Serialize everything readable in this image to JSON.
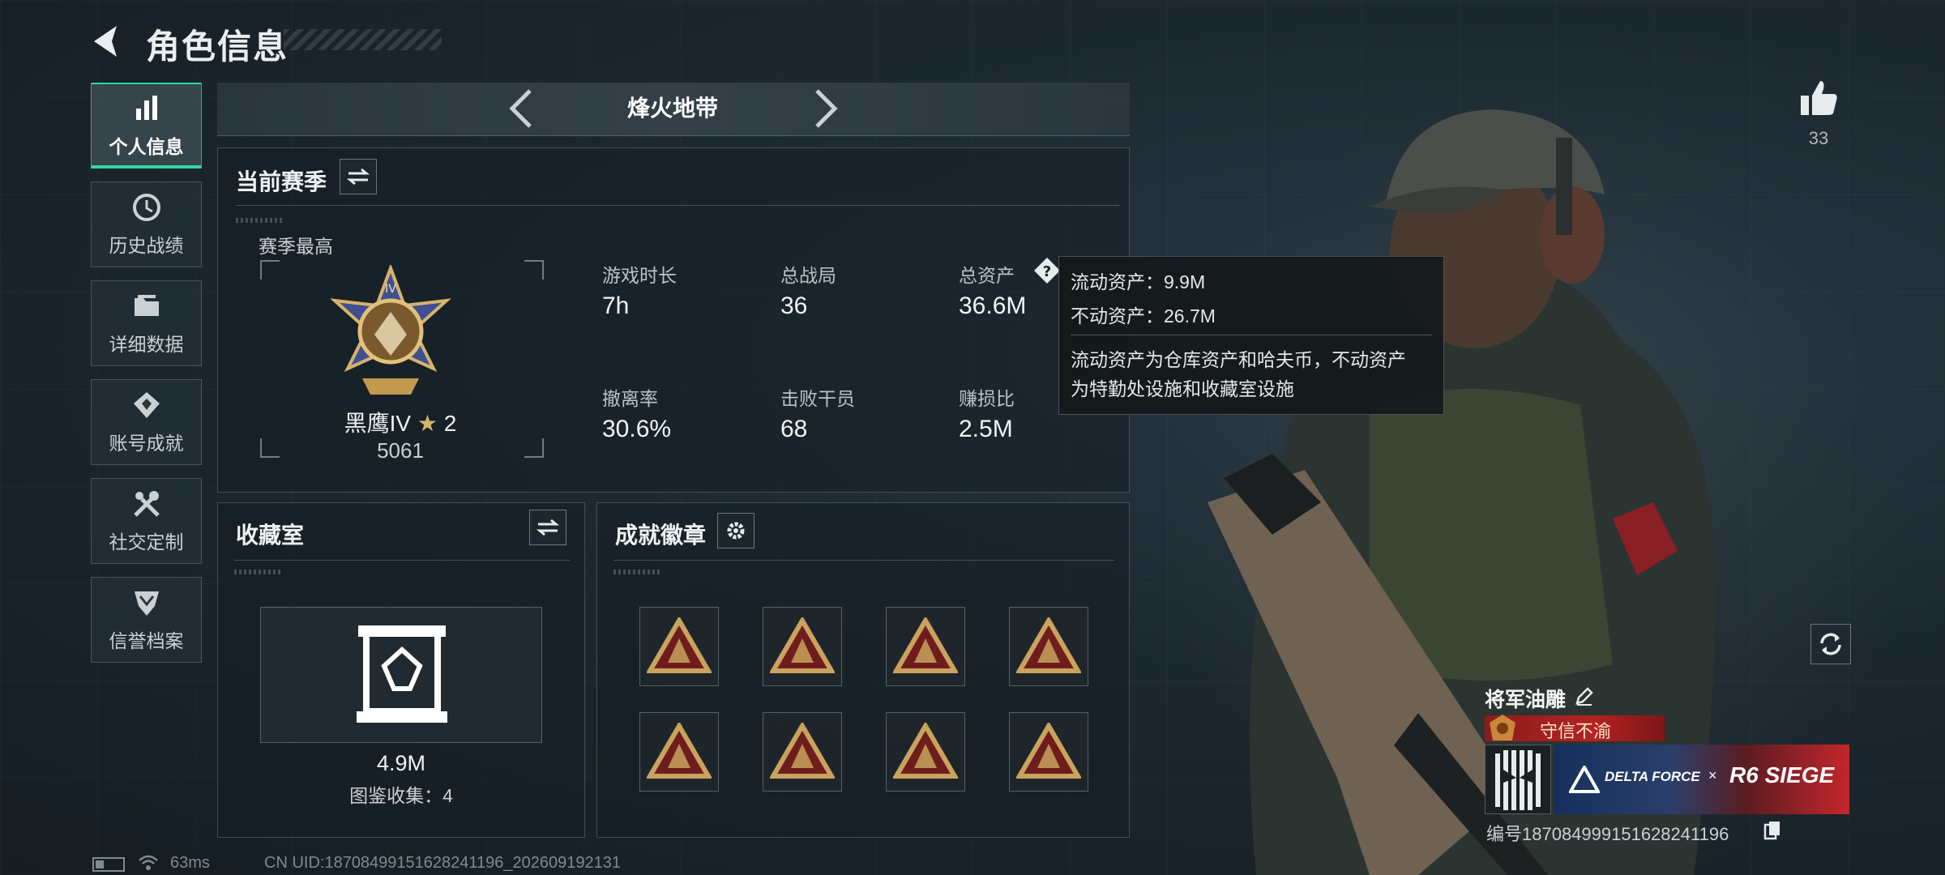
{
  "header": {
    "title": "角色信息"
  },
  "sidebar": {
    "items": [
      {
        "label": "个人信息",
        "icon": "bar-chart-icon",
        "active": true
      },
      {
        "label": "历史战绩",
        "icon": "clock-icon",
        "active": false
      },
      {
        "label": "详细数据",
        "icon": "folder-icon",
        "active": false
      },
      {
        "label": "账号成就",
        "icon": "achievement-icon",
        "active": false
      },
      {
        "label": "社交定制",
        "icon": "tools-icon",
        "active": false
      },
      {
        "label": "信誉档案",
        "icon": "shield-icon",
        "active": false
      }
    ]
  },
  "mode": {
    "label": "烽火地带"
  },
  "season": {
    "title": "当前赛季",
    "best_label": "赛季最高",
    "rank_name": "黑鹰IV",
    "rank_stars": "2",
    "rank_score": "5061",
    "stats": [
      {
        "label": "游戏时长",
        "value": "7h"
      },
      {
        "label": "总战局",
        "value": "36"
      },
      {
        "label": "总资产",
        "value": "36.6M"
      },
      {
        "label": "撤离率",
        "value": "30.6%"
      },
      {
        "label": "击败干员",
        "value": "68"
      },
      {
        "label": "赚损比",
        "value": "2.5M"
      }
    ]
  },
  "tooltip": {
    "liquid": "流动资产：9.9M",
    "fixed": "不动资产：26.7M",
    "desc_line1": "流动资产为仓库资产和哈夫币，不动资产",
    "desc_line2": "为特勤处设施和收藏室设施"
  },
  "collection": {
    "title": "收藏室",
    "value": "4.9M",
    "count_text": "图鉴收集：4"
  },
  "badges": {
    "title": "成就徽章",
    "items": [
      "badge-1",
      "badge-2",
      "badge-3",
      "badge-4",
      "badge-5",
      "badge-6",
      "badge-7",
      "badge-8"
    ],
    "colors": {
      "outer": "#c9a25e",
      "inner": "#6e1d1d"
    }
  },
  "character": {
    "likes": "33",
    "name": "将军油雕",
    "title_text": "守信不渝",
    "collab_left": "DELTA FORCE",
    "collab_x": "×",
    "collab_right": "R6 SIEGE",
    "id_text": "编号1870849991516282411​96"
  },
  "status": {
    "ping": "63ms",
    "uid": "CN UID:18708499151628241196_202609192131"
  },
  "colors": {
    "accent": "#2fd7a2",
    "banner_red": "#b32222"
  }
}
